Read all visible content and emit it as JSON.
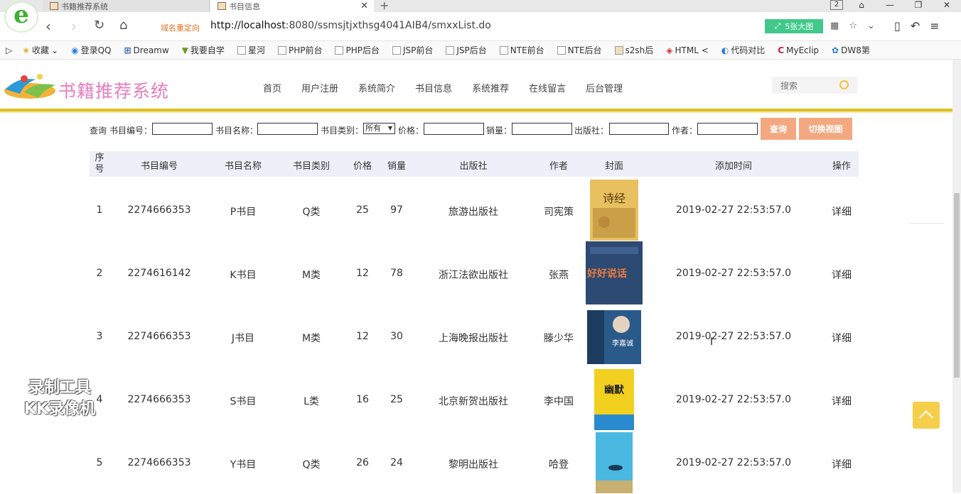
{
  "browser": {
    "tabs": [
      {
        "title": "书籍推荐系统"
      },
      {
        "title": "书目信息"
      }
    ],
    "tab_count": "2",
    "redirect_label": "域名重定向",
    "url_host": "http://localhost",
    "url_rest": ":8080/ssmsjtjxthsg4041AIB4/smxxList.do",
    "bigimg_label": "5张大图",
    "bookmarks": [
      "收藏",
      "登录QQ",
      "Dreamw",
      "我要自学",
      "星河",
      "PHP前台",
      "PHP后台",
      "JSP前台",
      "JSP后台",
      "NTE前台",
      "NTE后台",
      "s2sh后",
      "HTML <",
      "代码对比",
      "MyEclip",
      "DW8第"
    ]
  },
  "site": {
    "title": "书籍推荐系统",
    "nav": [
      "首页",
      "用户注册",
      "系统简介",
      "书目信息",
      "系统推荐",
      "在线留言",
      "后台管理"
    ],
    "search_placeholder": "搜索"
  },
  "query": {
    "prefix": "查询",
    "fields": {
      "book_no": "书目编号：",
      "book_name": "书目名称：",
      "book_type": "书目类别：",
      "price": "价格：",
      "sales": "销量：",
      "publisher": "出版社：",
      "author": "作者："
    },
    "type_selected": "所有",
    "search_button": "查询",
    "switch_view_button": "切换视图"
  },
  "table": {
    "headers": [
      "序号",
      "书目编号",
      "书目名称",
      "书目类别",
      "价格",
      "销量",
      "出版社",
      "作者",
      "封面",
      "添加时间",
      "操作"
    ],
    "rows": [
      {
        "idx": "1",
        "no": "2274666353",
        "name": "P书目",
        "type": "Q类",
        "price": "25",
        "sales": "97",
        "publisher": "旅游出版社",
        "author": "司宪策",
        "cover_text": "诗经",
        "time": "2019-02-27 22:53:57.0",
        "action": "详细"
      },
      {
        "idx": "2",
        "no": "2274616142",
        "name": "K书目",
        "type": "M类",
        "price": "12",
        "sales": "78",
        "publisher": "浙江法欲出版社",
        "author": "张燕",
        "cover_text": "好好说话",
        "time": "2019-02-27 22:53:57.0",
        "action": "详细"
      },
      {
        "idx": "3",
        "no": "2274666353",
        "name": "J书目",
        "type": "M类",
        "price": "12",
        "sales": "30",
        "publisher": "上海晚报出版社",
        "author": "滕少华",
        "cover_text": "李嘉诚",
        "time": "2019-02-27 22:53:57.0",
        "action": "详细"
      },
      {
        "idx": "4",
        "no": "2274666353",
        "name": "S书目",
        "type": "L类",
        "price": "16",
        "sales": "25",
        "publisher": "北京新贺出版社",
        "author": "李中国",
        "cover_text": "幽默",
        "time": "2019-02-27 22:53:57.0",
        "action": "详细"
      },
      {
        "idx": "5",
        "no": "2274666353",
        "name": "Y书目",
        "type": "Q类",
        "price": "26",
        "sales": "24",
        "publisher": "黎明出版社",
        "author": "哈登",
        "cover_text": "",
        "time": "2019-02-27 22:53:57.0",
        "action": "详细"
      }
    ]
  },
  "watermark": {
    "line1": "录制工具",
    "line2": "KK录像机"
  }
}
